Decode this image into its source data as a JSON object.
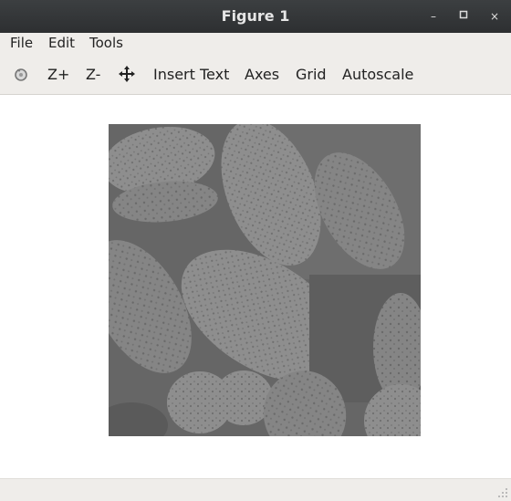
{
  "window": {
    "title": "Figure 1",
    "minimize_label": "–",
    "maximize_label": "□",
    "close_label": "×"
  },
  "menu": {
    "file": "File",
    "edit": "Edit",
    "tools": "Tools"
  },
  "toolbar": {
    "reset_icon": "rotate-reset-icon",
    "zoom_in": "Z+",
    "zoom_out": "Z-",
    "pan_icon": "move-arrows-icon",
    "insert_text": "Insert Text",
    "axes": "Axes",
    "grid": "Grid",
    "autoscale": "Autoscale"
  },
  "figure": {
    "image_content": "grayscale micrograph of pollen grains",
    "colors": {
      "background": "#6b6b6b",
      "grain": "#8a8a8a",
      "grain_light": "#9a9a9a",
      "shadow": "#555555"
    }
  }
}
